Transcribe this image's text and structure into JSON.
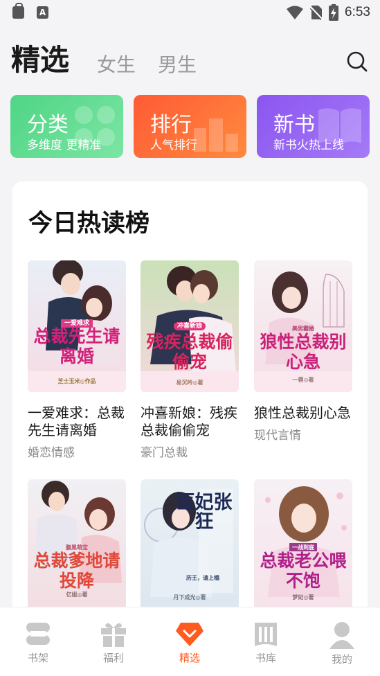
{
  "status_bar": {
    "time": "6:53",
    "left_icons": [
      "lock-icon",
      "text-app-icon"
    ],
    "app_glyph": "A"
  },
  "header": {
    "tabs": [
      {
        "label": "精选",
        "active": true
      },
      {
        "label": "女生",
        "active": false
      },
      {
        "label": "男生",
        "active": false
      }
    ]
  },
  "categories": [
    {
      "title": "分类",
      "subtitle": "多维度 更精准",
      "color": "#4fd585"
    },
    {
      "title": "排行",
      "subtitle": "人气排行",
      "color": "#ff6a38"
    },
    {
      "title": "新书",
      "subtitle": "新书火热上线",
      "color": "#9360f2"
    }
  ],
  "ranking": {
    "title": "今日热读榜",
    "books": [
      {
        "name": "一爱难求：总裁先生请离婚",
        "category": "婚恋情感",
        "cover_text": "总裁先生请离婚",
        "cover_tag": "一爱难求",
        "cover_author": "芝士玉米◎作品"
      },
      {
        "name": "冲喜新娘：残疾总裁偷偷宠",
        "category": "豪门总裁",
        "cover_text": "残疾总裁偷偷宠",
        "cover_tag": "冲喜新娘",
        "cover_author": "易沉吟◎著"
      },
      {
        "name": "狼性总裁别心急",
        "category": "现代言情",
        "cover_text": "狼性总裁别心急",
        "cover_tag": "美男霸婚",
        "cover_author": "一蓉◎著"
      },
      {
        "name": "",
        "category": "",
        "cover_text": "总裁爹地请投降",
        "cover_tag": "腹黑萌宝",
        "cover_author": "亿姐◎著"
      },
      {
        "name": "",
        "category": "",
        "cover_text": "医妃张狂",
        "cover_tag": "历王，请上榻",
        "cover_author": "月下成光◎著"
      },
      {
        "name": "",
        "category": "",
        "cover_text": "总裁老公喂不饱",
        "cover_tag": "一战到底",
        "cover_author": "梦妃◎著"
      }
    ]
  },
  "bottom_nav": [
    {
      "label": "书架",
      "icon": "bookshelf-icon",
      "active": false
    },
    {
      "label": "福利",
      "icon": "gift-icon",
      "active": false
    },
    {
      "label": "精选",
      "icon": "featured-gem-icon",
      "active": true
    },
    {
      "label": "书库",
      "icon": "library-icon",
      "active": false
    },
    {
      "label": "我的",
      "icon": "profile-icon",
      "active": false
    }
  ],
  "colors": {
    "accent": "#ff5a1f",
    "background": "#f4f4f6"
  }
}
